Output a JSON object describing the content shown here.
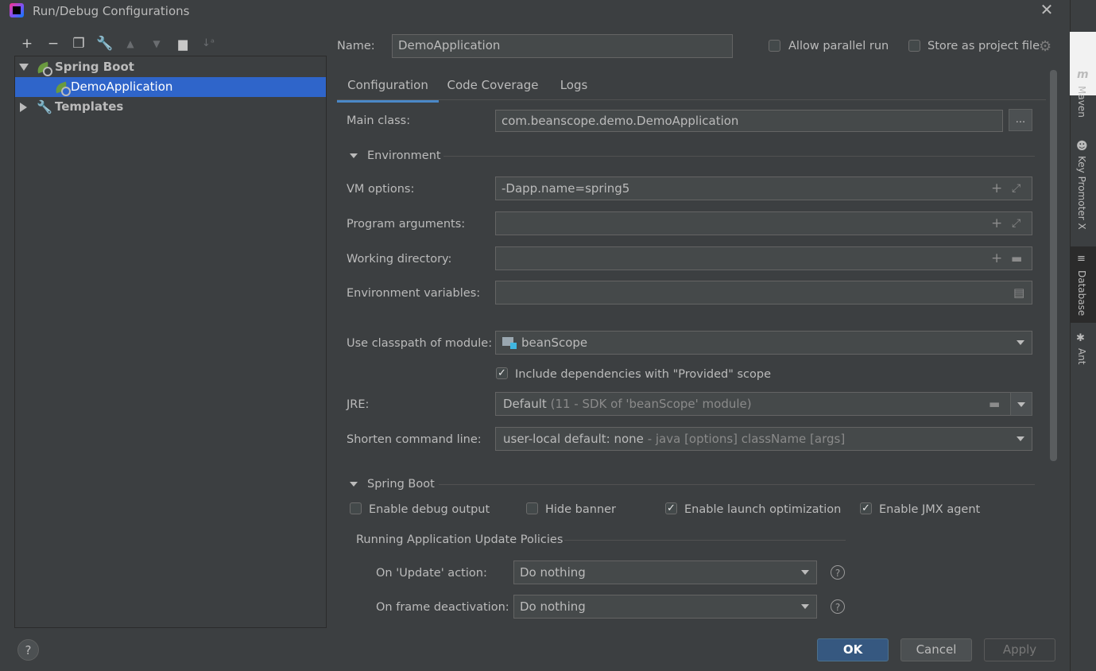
{
  "window": {
    "title": "Run/Debug Configurations"
  },
  "right_strip": {
    "maven": "Maven",
    "key_promoter": "Key Promoter X",
    "database": "Database",
    "ant": "Ant"
  },
  "tree": {
    "spring_boot": "Spring Boot",
    "demo_app": "DemoApplication",
    "templates": "Templates"
  },
  "form": {
    "name_label": "Name:",
    "name_value": "DemoApplication",
    "allow_parallel": "Allow parallel run",
    "store_project": "Store as project file",
    "tabs": [
      "Configuration",
      "Code Coverage",
      "Logs"
    ],
    "main_class_label": "Main class:",
    "main_class_value": "com.beanscope.demo.DemoApplication",
    "browse": "...",
    "environment": "Environment",
    "vm_options_label": "VM options:",
    "vm_options_value": "-Dapp.name=spring5",
    "program_args_label": "Program arguments:",
    "working_dir_label": "Working directory:",
    "env_vars_label": "Environment variables:",
    "classpath_label": "Use classpath of module:",
    "classpath_value": "beanScope",
    "include_deps": "Include dependencies with \"Provided\" scope",
    "jre_label": "JRE:",
    "jre_value": "Default",
    "jre_hint": "(11 - SDK of 'beanScope' module)",
    "shorten_label": "Shorten command line:",
    "shorten_value": "user-local default: none",
    "shorten_hint": "- java [options] className [args]",
    "spring_boot_section": "Spring Boot",
    "enable_debug": "Enable debug output",
    "hide_banner": "Hide banner",
    "enable_launch_opt": "Enable launch optimization",
    "enable_jmx": "Enable JMX agent",
    "policies": "Running Application Update Policies",
    "on_update_label": "On 'Update' action:",
    "on_update_value": "Do nothing",
    "on_frame_label": "On frame deactivation:",
    "on_frame_value": "Do nothing"
  },
  "buttons": {
    "ok": "OK",
    "cancel": "Cancel",
    "apply": "Apply",
    "help": "?"
  },
  "checkboxes": {
    "allow_parallel": false,
    "store_project": false,
    "include_deps": true,
    "enable_debug": false,
    "hide_banner": false,
    "enable_launch_opt": true,
    "enable_jmx": true
  },
  "colors": {
    "background": "#3c3f41",
    "selection": "#2f65ca",
    "primary_button": "#365880",
    "tab_underline": "#4a88c7"
  }
}
